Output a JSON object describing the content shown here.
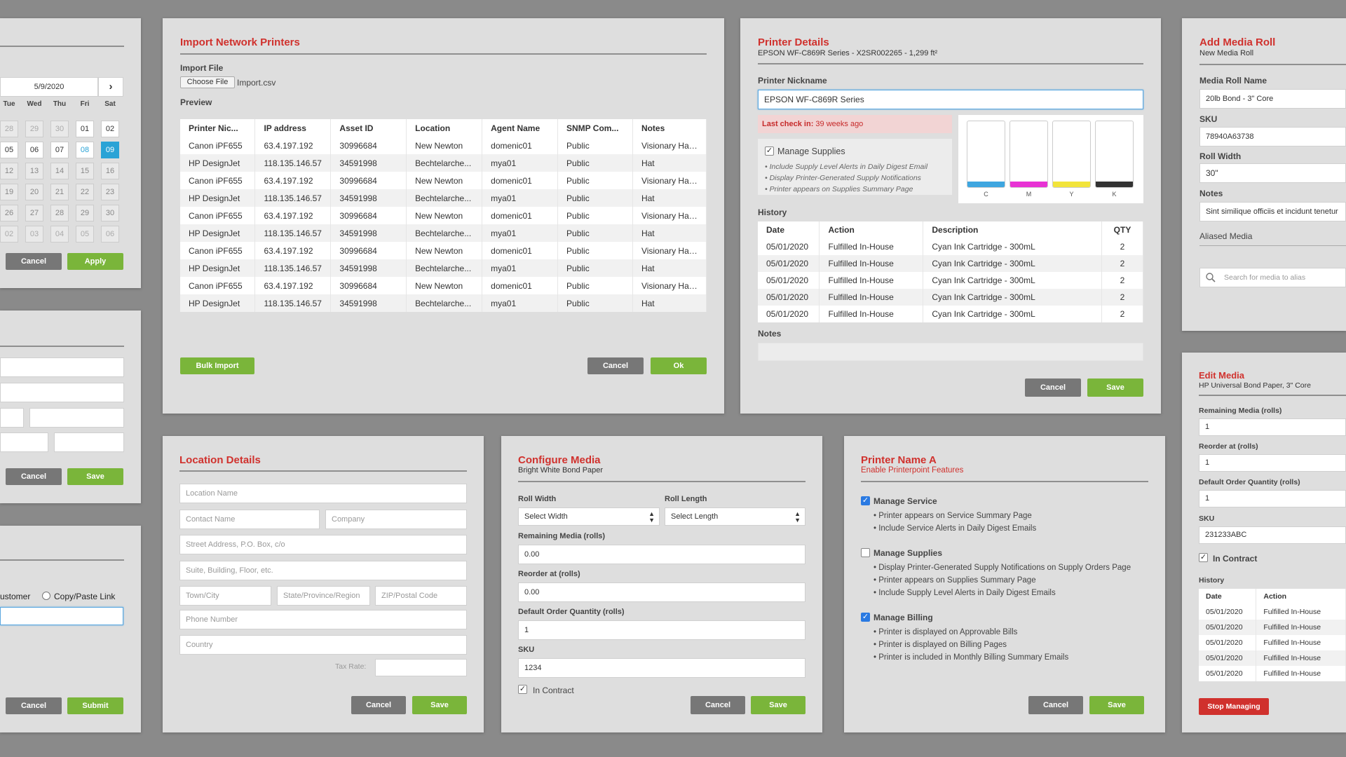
{
  "calendar": {
    "date": "5/9/2020",
    "weekdays": [
      "Tue",
      "Wed",
      "Thu",
      "Fri",
      "Sat"
    ],
    "rows": [
      [
        "28",
        "29",
        "30",
        "01",
        "02"
      ],
      [
        "05",
        "06",
        "07",
        "08",
        "09"
      ],
      [
        "12",
        "13",
        "14",
        "15",
        "16"
      ],
      [
        "19",
        "20",
        "21",
        "22",
        "23"
      ],
      [
        "26",
        "27",
        "28",
        "29",
        "30"
      ],
      [
        "02",
        "03",
        "04",
        "05",
        "06"
      ]
    ],
    "cancel": "Cancel",
    "apply": "Apply"
  },
  "left_mid": {
    "cancel": "Cancel",
    "save": "Save"
  },
  "left_bot": {
    "radio_customer": "ustomer",
    "radio_copy": "Copy/Paste Link",
    "cancel": "Cancel",
    "submit": "Submit"
  },
  "import": {
    "title": "Import Network Printers",
    "file_label": "Import File",
    "choose_file": "Choose File",
    "file_name": "Import.csv",
    "preview_label": "Preview",
    "columns": [
      "Printer Nic...",
      "IP address",
      "Asset ID",
      "Location",
      "Agent Name",
      "SNMP Com...",
      "Notes"
    ],
    "rows": [
      [
        "Canon iPF655",
        "63.4.197.192",
        "30996684",
        "New Newton",
        "domenic01",
        "Public",
        "Visionary Han..."
      ],
      [
        "HP DesignJet",
        "118.135.146.57",
        "34591998",
        "Bechtelarche...",
        "mya01",
        "Public",
        "Hat"
      ],
      [
        "Canon iPF655",
        "63.4.197.192",
        "30996684",
        "New Newton",
        "domenic01",
        "Public",
        "Visionary Han..."
      ],
      [
        "HP DesignJet",
        "118.135.146.57",
        "34591998",
        "Bechtelarche...",
        "mya01",
        "Public",
        "Hat"
      ],
      [
        "Canon iPF655",
        "63.4.197.192",
        "30996684",
        "New Newton",
        "domenic01",
        "Public",
        "Visionary Han..."
      ],
      [
        "HP DesignJet",
        "118.135.146.57",
        "34591998",
        "Bechtelarche...",
        "mya01",
        "Public",
        "Hat"
      ],
      [
        "Canon iPF655",
        "63.4.197.192",
        "30996684",
        "New Newton",
        "domenic01",
        "Public",
        "Visionary Han..."
      ],
      [
        "HP DesignJet",
        "118.135.146.57",
        "34591998",
        "Bechtelarche...",
        "mya01",
        "Public",
        "Hat"
      ],
      [
        "Canon iPF655",
        "63.4.197.192",
        "30996684",
        "New Newton",
        "domenic01",
        "Public",
        "Visionary Han..."
      ],
      [
        "HP DesignJet",
        "118.135.146.57",
        "34591998",
        "Bechtelarche...",
        "mya01",
        "Public",
        "Hat"
      ]
    ],
    "bulk_import": "Bulk Import",
    "cancel": "Cancel",
    "ok": "Ok"
  },
  "printer_details": {
    "title": "Printer Details",
    "subtitle": "EPSON WF-C869R Series - X2SR002265 - 1,299 ft²",
    "nickname_label": "Printer Nickname",
    "nickname_value": "EPSON WF-C869R Series",
    "last_checkin_label": "Last check in:",
    "last_checkin_value": "39 weeks ago",
    "manage_supplies": "Manage Supplies",
    "supply_notes": [
      "• Include Supply Level Alerts in Daily Digest Email",
      "• Display Printer-Generated Supply Notifications",
      "• Printer appears on Supplies Summary Page"
    ],
    "ink": [
      {
        "label": "C",
        "color": "#3ea6e0"
      },
      {
        "label": "M",
        "color": "#e832d4"
      },
      {
        "label": "Y",
        "color": "#f2e43a"
      },
      {
        "label": "K",
        "color": "#333333"
      }
    ],
    "history_label": "History",
    "history_columns": [
      "Date",
      "Action",
      "Description",
      "QTY"
    ],
    "history_rows": [
      [
        "05/01/2020",
        "Fulfilled In-House",
        "Cyan Ink Cartridge - 300mL",
        "2"
      ],
      [
        "05/01/2020",
        "Fulfilled In-House",
        "Cyan Ink Cartridge - 300mL",
        "2"
      ],
      [
        "05/01/2020",
        "Fulfilled In-House",
        "Cyan Ink Cartridge - 300mL",
        "2"
      ],
      [
        "05/01/2020",
        "Fulfilled In-House",
        "Cyan Ink Cartridge - 300mL",
        "2"
      ],
      [
        "05/01/2020",
        "Fulfilled In-House",
        "Cyan Ink Cartridge - 300mL",
        "2"
      ]
    ],
    "notes_label": "Notes",
    "cancel": "Cancel",
    "save": "Save"
  },
  "add_media": {
    "title": "Add Media Roll",
    "subtitle": "New Media Roll",
    "name_label": "Media Roll Name",
    "name_value": "20lb Bond - 3\" Core",
    "sku_label": "SKU",
    "sku_value": "78940A63738",
    "width_label": "Roll Width",
    "width_value": "30\"",
    "notes_label": "Notes",
    "notes_value": "Sint similique officiis et incidunt tenetur",
    "aliased_label": "Aliased Media",
    "search_placeholder": "Search for media to alias"
  },
  "edit_media": {
    "title": "Edit Media",
    "subtitle": "HP Universal Bond Paper, 3\" Core",
    "remaining_label": "Remaining Media (rolls)",
    "remaining_value": "1",
    "reorder_label": "Reorder at (rolls)",
    "reorder_value": "1",
    "default_label": "Default Order Quantity (rolls)",
    "default_value": "1",
    "sku_label": "SKU",
    "sku_value": "231233ABC",
    "in_contract": "In Contract",
    "history_label": "History",
    "history_columns": [
      "Date",
      "Action"
    ],
    "history_rows": [
      [
        "05/01/2020",
        "Fulfilled In-House"
      ],
      [
        "05/01/2020",
        "Fulfilled In-House"
      ],
      [
        "05/01/2020",
        "Fulfilled In-House"
      ],
      [
        "05/01/2020",
        "Fulfilled In-House"
      ],
      [
        "05/01/2020",
        "Fulfilled In-House"
      ]
    ],
    "stop": "Stop Managing"
  },
  "location": {
    "title": "Location Details",
    "location_name": "Location Name",
    "contact_name": "Contact Name",
    "company": "Company",
    "street": "Street Address, P.O. Box, c/o",
    "suite": "Suite, Building, Floor, etc.",
    "town": "Town/City",
    "state": "State/Province/Region",
    "zip": "ZIP/Postal Code",
    "phone": "Phone Number",
    "country": "Country",
    "tax_label": "Tax Rate:",
    "cancel": "Cancel",
    "save": "Save"
  },
  "configure": {
    "title": "Configure Media",
    "subtitle": "Bright White Bond Paper",
    "width_label": "Roll Width",
    "width_value": "Select Width",
    "length_label": "Roll Length",
    "length_value": "Select Length",
    "remaining_label": "Remaining Media (rolls)",
    "remaining_value": "0.00",
    "reorder_label": "Reorder at (rolls)",
    "reorder_value": "0.00",
    "default_label": "Default Order Quantity (rolls)",
    "default_value": "1",
    "sku_label": "SKU",
    "sku_value": "1234",
    "in_contract": "In Contract",
    "cancel": "Cancel",
    "save": "Save"
  },
  "printer_name": {
    "title": "Printer Name A",
    "subtitle": "Enable Printerpoint Features",
    "service_label": "Manage Service",
    "service_items": [
      "• Printer appears on Service Summary Page",
      "• Include Service Alerts in Daily Digest Emails"
    ],
    "supplies_label": "Manage Supplies",
    "supplies_items": [
      "• Display Printer-Generated Supply Notifications on Supply Orders Page",
      "• Printer appears on Supplies Summary Page",
      "• Include Supply Level Alerts in Daily Digest Emails"
    ],
    "billing_label": "Manage Billing",
    "billing_items": [
      "• Printer is displayed on Approvable Bills",
      "• Printer is displayed on Billing Pages",
      "• Printer is included in Monthly Billing Summary Emails"
    ],
    "cancel": "Cancel",
    "save": "Save"
  }
}
